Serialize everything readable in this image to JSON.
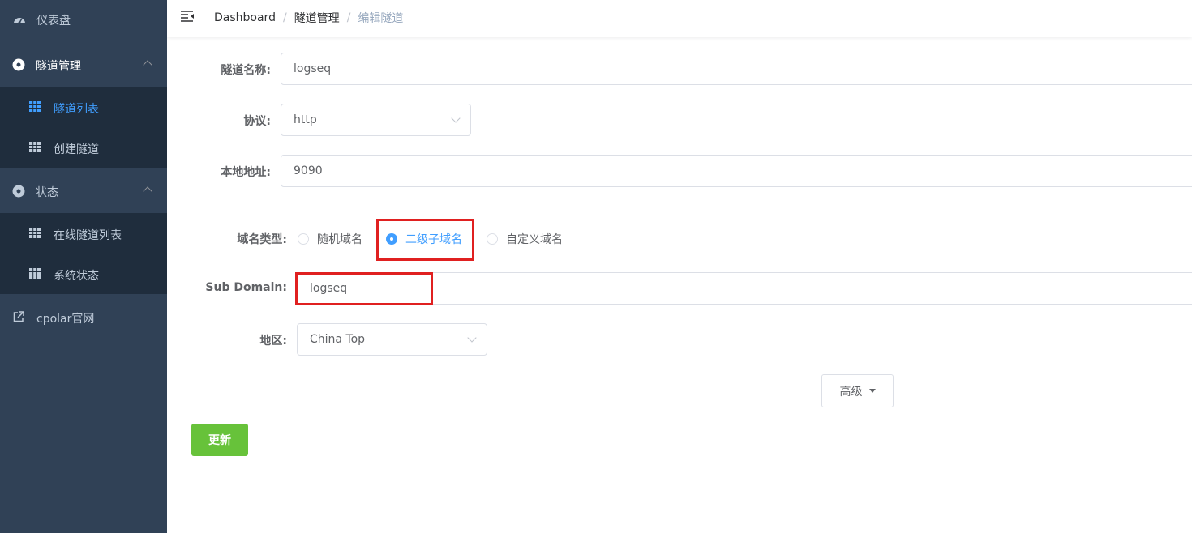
{
  "sidebar": {
    "dashboard": {
      "label": "仪表盘",
      "icon": "dashboard-icon"
    },
    "tunnel_mgmt": {
      "label": "隧道管理",
      "icon": "circle-icon"
    },
    "tunnel_list": {
      "label": "隧道列表",
      "icon": "table-icon"
    },
    "create_tunnel": {
      "label": "创建隧道",
      "icon": "table-icon"
    },
    "status": {
      "label": "状态",
      "icon": "circle-icon"
    },
    "online_tunnels": {
      "label": "在线隧道列表",
      "icon": "table-icon"
    },
    "system_status": {
      "label": "系统状态",
      "icon": "table-icon"
    },
    "website": {
      "label": "cpolar官网",
      "icon": "external-link-icon"
    }
  },
  "breadcrumb": [
    "Dashboard",
    "隧道管理",
    "编辑隧道"
  ],
  "form": {
    "name_label": "隧道名称:",
    "name_value": "logseq",
    "protocol_label": "协议:",
    "protocol_value": "http",
    "local_label": "本地地址:",
    "local_value": "9090",
    "domain_type_label": "域名类型:",
    "domain_options": [
      "随机域名",
      "二级子域名",
      "自定义域名"
    ],
    "domain_selected": "二级子域名",
    "subdomain_label": "Sub Domain:",
    "subdomain_value": "logseq",
    "region_label": "地区:",
    "region_value": "China Top",
    "advanced_label": "高级",
    "update_label": "更新"
  },
  "colors": {
    "sidebar_bg": "#304156",
    "submenu_bg": "#1f2d3d",
    "active": "#409eff",
    "update_button": "#67c23a",
    "highlight": "#e02020"
  }
}
